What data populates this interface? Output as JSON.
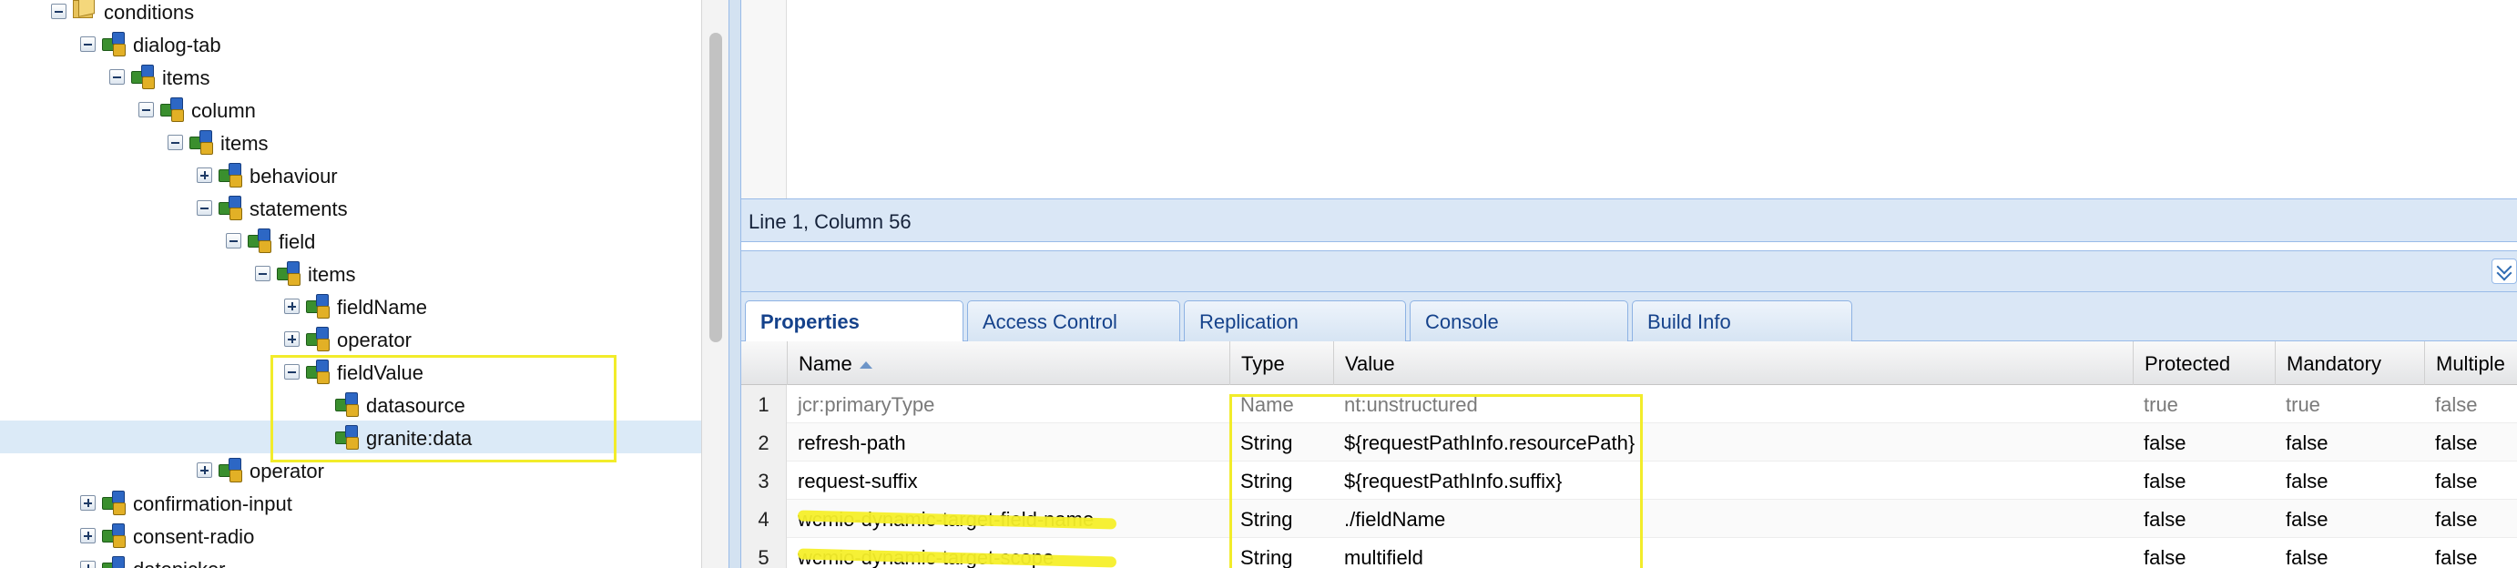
{
  "tree": {
    "nodes": [
      {
        "label": "conditions",
        "indent": 0,
        "toggle": "minus",
        "icon": "folder-icon"
      },
      {
        "label": "dialog-tab",
        "indent": 1,
        "toggle": "minus",
        "icon": "node-icon"
      },
      {
        "label": "items",
        "indent": 2,
        "toggle": "minus",
        "icon": "node-icon"
      },
      {
        "label": "column",
        "indent": 3,
        "toggle": "minus",
        "icon": "node-icon"
      },
      {
        "label": "items",
        "indent": 4,
        "toggle": "minus",
        "icon": "node-icon"
      },
      {
        "label": "behaviour",
        "indent": 5,
        "toggle": "plus",
        "icon": "node-icon"
      },
      {
        "label": "statements",
        "indent": 5,
        "toggle": "minus",
        "icon": "node-icon"
      },
      {
        "label": "field",
        "indent": 6,
        "toggle": "minus",
        "icon": "node-icon"
      },
      {
        "label": "items",
        "indent": 7,
        "toggle": "minus",
        "icon": "node-icon"
      },
      {
        "label": "fieldName",
        "indent": 8,
        "toggle": "plus",
        "icon": "node-icon"
      },
      {
        "label": "operator",
        "indent": 8,
        "toggle": "plus",
        "icon": "node-icon"
      },
      {
        "label": "fieldValue",
        "indent": 8,
        "toggle": "minus",
        "icon": "node-icon"
      },
      {
        "label": "datasource",
        "indent": 9,
        "toggle": "none",
        "icon": "node-icon"
      },
      {
        "label": "granite:data",
        "indent": 9,
        "toggle": "none",
        "icon": "node-icon",
        "selected": true
      },
      {
        "label": "operator",
        "indent": 5,
        "toggle": "plus",
        "icon": "node-icon"
      },
      {
        "label": "confirmation-input",
        "indent": 1,
        "toggle": "plus",
        "icon": "node-icon"
      },
      {
        "label": "consent-radio",
        "indent": 1,
        "toggle": "plus",
        "icon": "node-icon"
      },
      {
        "label": "datepicker",
        "indent": 1,
        "toggle": "plus",
        "icon": "node-icon"
      }
    ]
  },
  "editor": {
    "status": "Line 1, Column 56"
  },
  "tabs": [
    "Properties",
    "Access Control",
    "Replication",
    "Console",
    "Build Info"
  ],
  "active_tab": "Properties",
  "grid": {
    "columns": [
      "Name",
      "Type",
      "Value",
      "Protected",
      "Mandatory",
      "Multiple"
    ],
    "sort_column": "Name",
    "rows": [
      {
        "num": "1",
        "name": "jcr:primaryType",
        "type": "Name",
        "value": "nt:unstructured",
        "protected": "true",
        "mandatory": "true",
        "multiple": "false",
        "style": "grey"
      },
      {
        "num": "2",
        "name": "refresh-path",
        "type": "String",
        "value": "${requestPathInfo.resourcePath}",
        "protected": "false",
        "mandatory": "false",
        "multiple": "false"
      },
      {
        "num": "3",
        "name": "request-suffix",
        "type": "String",
        "value": "${requestPathInfo.suffix}",
        "protected": "false",
        "mandatory": "false",
        "multiple": "false"
      },
      {
        "num": "4",
        "name": "wcmio-dynamic-target-field-name",
        "type": "String",
        "value": "./fieldName",
        "protected": "false",
        "mandatory": "false",
        "multiple": "false",
        "redacted": true
      },
      {
        "num": "5",
        "name": "wcmio-dynamic-target-scope",
        "type": "String",
        "value": "multifield",
        "protected": "false",
        "mandatory": "false",
        "multiple": "false",
        "redacted": true
      }
    ]
  },
  "colors": {
    "highlight": "#f2ec2a",
    "selected_row": "#dbeaf7",
    "tab_text": "#15428b"
  }
}
